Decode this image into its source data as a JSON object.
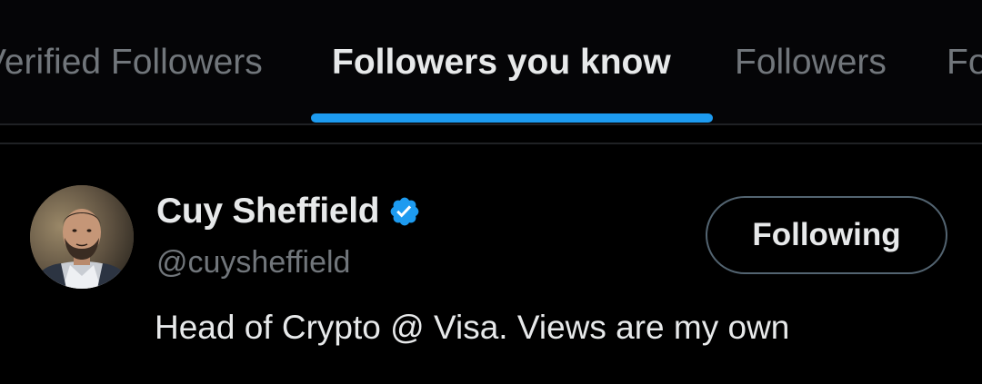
{
  "tabs": [
    {
      "label": "Verified Followers",
      "active": false
    },
    {
      "label": "Followers you know",
      "active": true
    },
    {
      "label": "Followers",
      "active": false
    },
    {
      "label": "Following",
      "active": false
    }
  ],
  "user": {
    "display_name": "Cuy Sheffield",
    "verified": true,
    "handle": "@cuysheffield",
    "bio": "Head of Crypto @ Visa. Views are my own",
    "follow_button_label": "Following"
  },
  "colors": {
    "accent": "#1d9bf0",
    "background": "#000000",
    "text_primary": "#e7e9ea",
    "text_secondary": "#71767b"
  },
  "icons": {
    "verified": "verified-badge-icon"
  }
}
